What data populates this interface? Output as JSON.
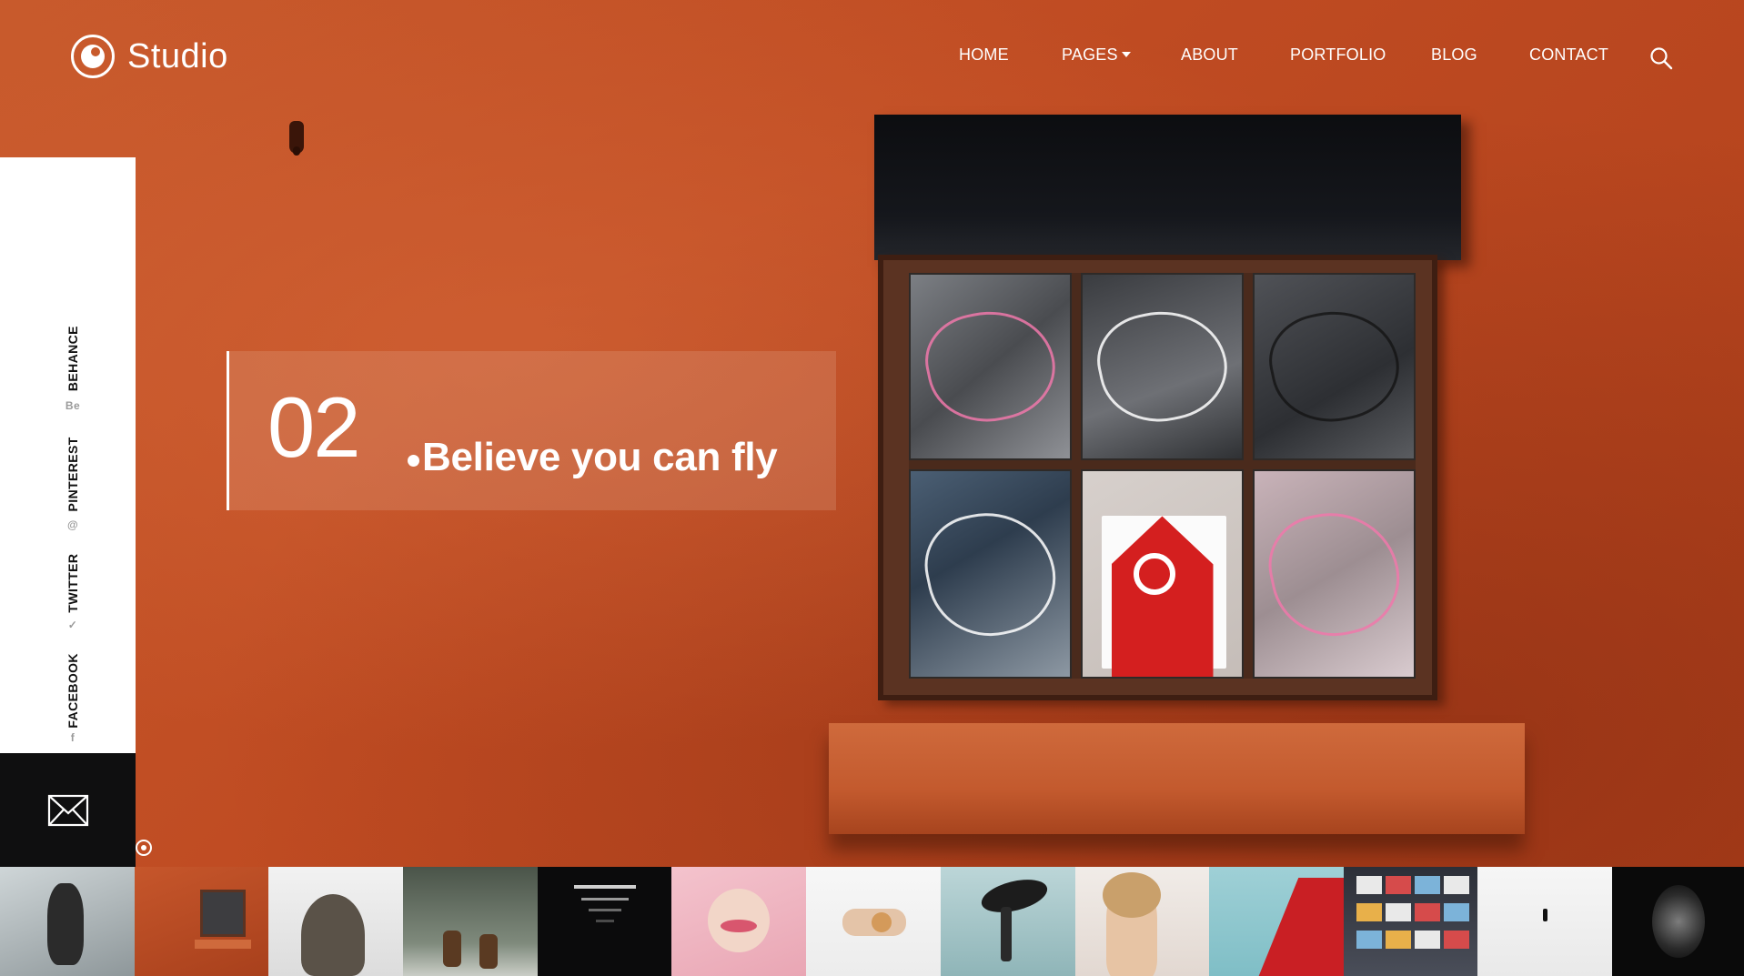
{
  "brand": {
    "name": "Studio"
  },
  "nav": {
    "items": [
      {
        "label": "HOME"
      },
      {
        "label": "PAGES",
        "has_dropdown": true
      },
      {
        "label": "ABOUT"
      },
      {
        "label": "PORTFOLIO"
      },
      {
        "label": "BLOG"
      },
      {
        "label": "CONTACT"
      }
    ],
    "search_icon": "search-icon"
  },
  "social": {
    "items": [
      {
        "label": "FACEBOOK",
        "icon": "f"
      },
      {
        "label": "TWITTER",
        "icon": "✓"
      },
      {
        "label": "PINTEREST",
        "icon": "@"
      },
      {
        "label": "BEHANCE",
        "icon": "Be"
      }
    ],
    "mail_icon": "envelope-icon"
  },
  "slide": {
    "number": "02",
    "title": "Believe you can fly"
  },
  "thumbnails": {
    "count": 13,
    "active_index": 1
  },
  "colors": {
    "wall": "#c1542a",
    "panel": "#ffffff",
    "mail_box": "#0f0f10",
    "text_light": "#ffffff"
  }
}
